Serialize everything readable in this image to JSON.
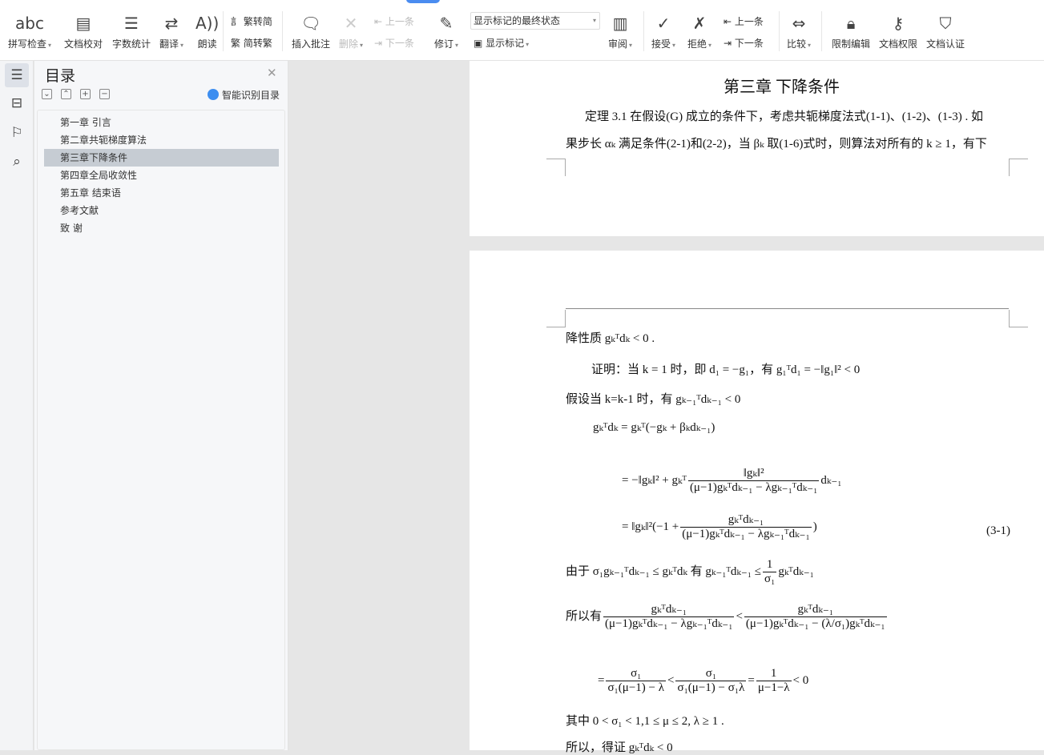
{
  "toolbar": {
    "spell_check": "拼写检查",
    "doc_proof": "文档校对",
    "word_count": "字数统计",
    "translate": "翻译",
    "read_aloud": "朗读",
    "trad_to_simp": "繁转简",
    "simp_to_trad": "简转繁",
    "insert_comment": "插入批注",
    "delete": "删除",
    "prev_comment": "上一条",
    "next_comment": "下一条",
    "track_changes": "修订",
    "markup_dropdown": "显示标记的最终状态",
    "show_markup": "显示标记",
    "review_pane": "审阅",
    "accept": "接受",
    "reject": "拒绝",
    "prev_change": "上一条",
    "next_change": "下一条",
    "compare": "比较",
    "restrict_edit": "限制编辑",
    "doc_permission": "文档权限",
    "doc_certify": "文档认证"
  },
  "panel": {
    "title": "目录",
    "smart_toc": "智能识别目录",
    "items": [
      "第一章  引言",
      "第二章共轭梯度算法",
      "第三章下降条件",
      "第四章全局收敛性",
      "第五章  结束语",
      "参考文献",
      "致    谢"
    ],
    "selected": 2
  },
  "doc": {
    "heading": "第三章  下降条件",
    "p1": "定理 3.1    在假设(G) 成立的条件下，考虑共轭梯度法式(1-1)、(1-2)、(1-3) . 如",
    "p2": "果步长 αₖ 满足条件(2-1)和(2-2)，当 βₖ 取(1-6)式时，则算法对所有的 k ≥ 1，有下",
    "l1": "降性质  gₖᵀdₖ < 0  .",
    "l2": "证明：当 k = 1 时，即 d₁ = −g₁，有 g₁ᵀd₁ = −‖g₁‖² < 0",
    "l3": "假设当 k=k-1 时，有 gₖ₋₁ᵀdₖ₋₁ < 0",
    "l4": "gₖᵀdₖ = gₖᵀ(−gₖ + βₖdₖ₋₁)",
    "l5a": "= −‖gₖ‖² + gₖᵀ",
    "l5num": "‖gₖ‖²",
    "l5den": "(μ−1)gₖᵀdₖ₋₁ − λgₖ₋₁ᵀdₖ₋₁",
    "l5b": "dₖ₋₁",
    "l6a": "= ‖gₖ‖²(−1 +",
    "l6num": "gₖᵀdₖ₋₁",
    "l6den": "(μ−1)gₖᵀdₖ₋₁ − λgₖ₋₁ᵀdₖ₋₁",
    "l6b": ")",
    "eqno": "(3-1)",
    "l7a": "由于 σ₁gₖ₋₁ᵀdₖ₋₁ ≤ gₖᵀdₖ 有 gₖ₋₁ᵀdₖ₋₁ ≤",
    "l7num": "1",
    "l7den": "σ₁",
    "l7b": "gₖᵀdₖ₋₁",
    "l8a": "所以有",
    "l8n1": "gₖᵀdₖ₋₁",
    "l8d1": "(μ−1)gₖᵀdₖ₋₁ − λgₖ₋₁ᵀdₖ₋₁",
    "l8lt": "<",
    "l8n2": "gₖᵀdₖ₋₁",
    "l8d2": "(μ−1)gₖᵀdₖ₋₁ − (λ/σ₁)gₖᵀdₖ₋₁",
    "l9a": "=",
    "l9n1": "σ₁",
    "l9d1": "σ₁(μ−1) − λ",
    "l9lt": "<",
    "l9n2": "σ₁",
    "l9d2": "σ₁(μ−1) − σ₁λ",
    "l9eq": "=",
    "l9n3": "1",
    "l9d3": "μ−1−λ",
    "l9b": "< 0",
    "l10": "其中  0 < σ₁ < 1,1 ≤ μ ≤ 2, λ ≥ 1  .",
    "l11": "所以，得证 gₖᵀdₖ < 0"
  }
}
